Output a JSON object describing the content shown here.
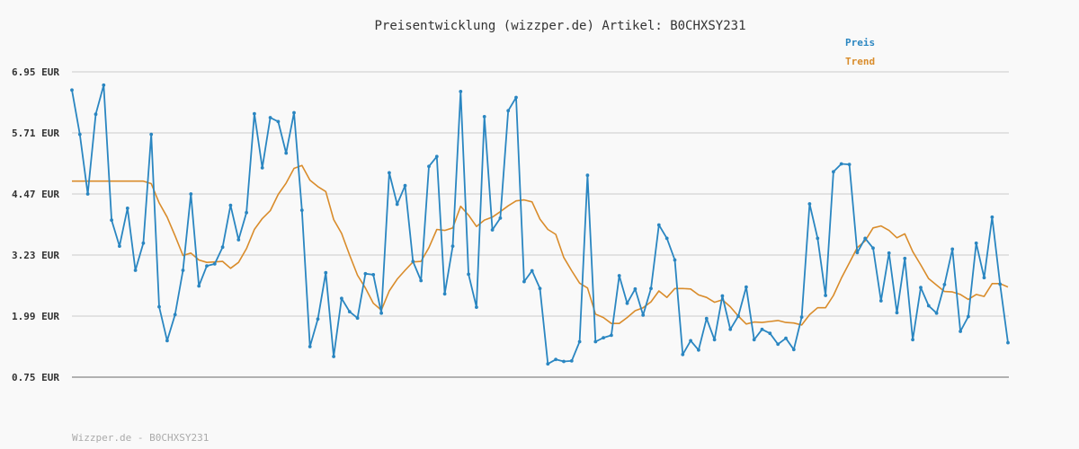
{
  "chart_data": {
    "type": "line",
    "title": "Preisentwicklung (wizzper.de) Artikel: B0CHXSY231",
    "footer": "Wizzper.de - B0CHXSY231",
    "ylim": [
      0.75,
      6.95
    ],
    "yticks": [
      0.75,
      1.99,
      3.23,
      4.47,
      5.71,
      6.95
    ],
    "ytick_labels": [
      "0.75 EUR",
      "1.99 EUR",
      "3.23 EUR",
      "4.47 EUR",
      "5.71 EUR",
      "6.95 EUR"
    ],
    "grid": true,
    "legend_position": "top-right",
    "colors": {
      "Preis": "#2a86c1",
      "Trend": "#d98c2b"
    },
    "series": [
      {
        "name": "Preis",
        "values": [
          6.58,
          5.68,
          4.47,
          6.09,
          6.68,
          3.94,
          3.41,
          4.18,
          2.92,
          3.47,
          5.68,
          2.18,
          1.49,
          2.02,
          2.92,
          4.47,
          2.6,
          3.01,
          3.05,
          3.39,
          4.24,
          3.54,
          4.09,
          6.1,
          5.0,
          6.02,
          5.94,
          5.3,
          6.12,
          4.14,
          1.37,
          1.93,
          2.87,
          1.17,
          2.35,
          2.08,
          1.95,
          2.85,
          2.83,
          2.05,
          4.9,
          4.26,
          4.64,
          3.1,
          2.71,
          5.03,
          5.23,
          2.44,
          3.41,
          6.55,
          2.84,
          2.17,
          6.04,
          3.74,
          3.98,
          6.16,
          6.43,
          2.69,
          2.91,
          2.55,
          1.02,
          1.11,
          1.07,
          1.08,
          1.47,
          4.85,
          1.47,
          1.55,
          1.6,
          2.81,
          2.25,
          2.54,
          2.01,
          2.55,
          3.84,
          3.57,
          3.13,
          1.21,
          1.49,
          1.3,
          1.94,
          1.51,
          2.4,
          1.72,
          1.99,
          2.58,
          1.51,
          1.72,
          1.64,
          1.42,
          1.54,
          1.31,
          1.97,
          4.27,
          3.57,
          2.41,
          4.92,
          5.08,
          5.07,
          3.28,
          3.57,
          3.37,
          2.3,
          3.27,
          2.06,
          3.16,
          1.51,
          2.57,
          2.2,
          2.05,
          2.63,
          3.35,
          1.68,
          1.98,
          3.47,
          2.77,
          4.0,
          2.64,
          1.45
        ]
      },
      {
        "name": "Trend",
        "values": [
          4.73,
          4.73,
          4.73,
          4.73,
          4.73,
          4.73,
          4.73,
          4.73,
          4.73,
          4.73,
          4.68,
          4.29,
          4.0,
          3.62,
          3.22,
          3.27,
          3.13,
          3.08,
          3.09,
          3.1,
          2.96,
          3.08,
          3.36,
          3.75,
          3.97,
          4.13,
          4.46,
          4.69,
          4.99,
          5.05,
          4.75,
          4.62,
          4.52,
          3.95,
          3.67,
          3.23,
          2.82,
          2.56,
          2.25,
          2.11,
          2.5,
          2.74,
          2.92,
          3.09,
          3.1,
          3.38,
          3.75,
          3.73,
          3.78,
          4.22,
          4.04,
          3.81,
          3.94,
          4.0,
          4.11,
          4.23,
          4.33,
          4.35,
          4.31,
          3.96,
          3.75,
          3.65,
          3.18,
          2.91,
          2.66,
          2.56,
          2.03,
          1.96,
          1.84,
          1.84,
          1.96,
          2.1,
          2.16,
          2.28,
          2.5,
          2.37,
          2.55,
          2.55,
          2.54,
          2.42,
          2.37,
          2.27,
          2.32,
          2.18,
          1.99,
          1.83,
          1.87,
          1.86,
          1.88,
          1.9,
          1.86,
          1.85,
          1.81,
          2.02,
          2.16,
          2.16,
          2.41,
          2.76,
          3.07,
          3.38,
          3.52,
          3.78,
          3.82,
          3.73,
          3.58,
          3.66,
          3.3,
          3.03,
          2.75,
          2.62,
          2.49,
          2.48,
          2.43,
          2.33,
          2.43,
          2.39,
          2.65,
          2.65,
          2.58
        ]
      }
    ]
  }
}
